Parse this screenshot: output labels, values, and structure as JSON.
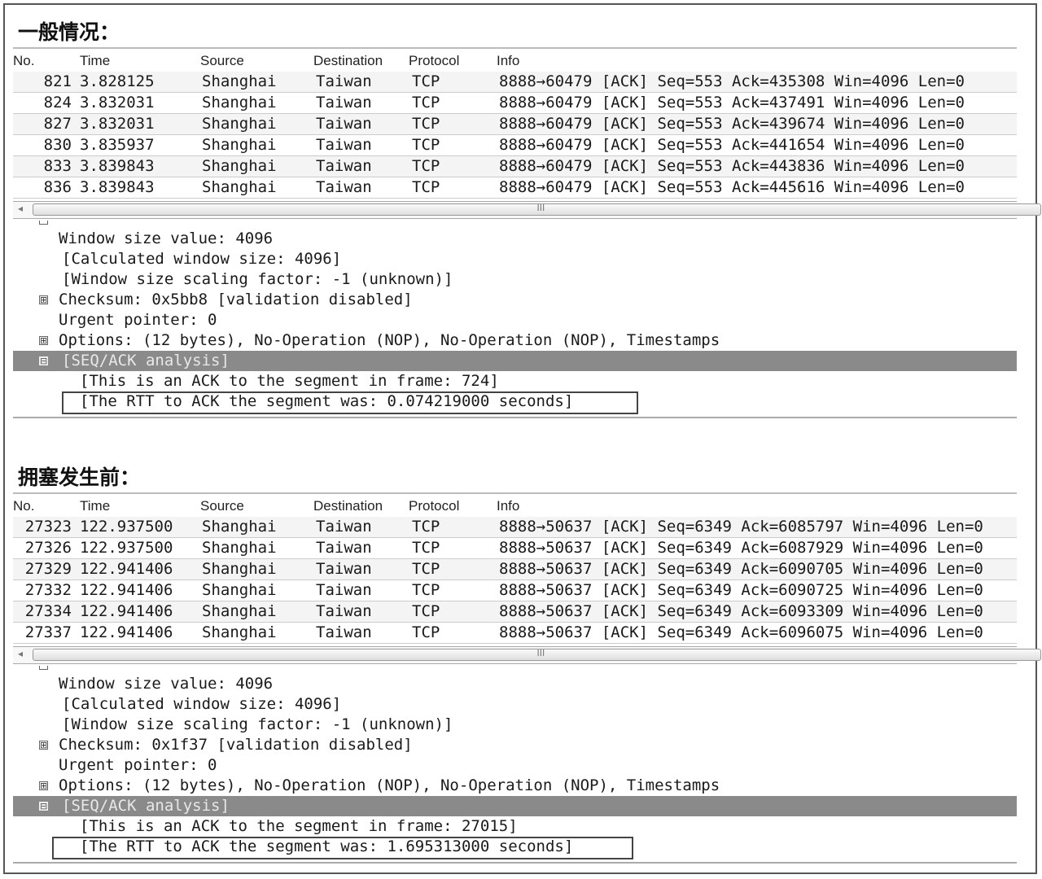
{
  "sections": [
    {
      "title": "一般情况：",
      "columns": [
        "No.",
        "Time",
        "Source",
        "Destination",
        "Protocol",
        "Info"
      ],
      "rows": [
        {
          "no": "821",
          "time": "3.828125",
          "src": "Shanghai",
          "dst": "Taiwan",
          "proto": "TCP",
          "info": "8888→60479 [ACK] Seq=553 Ack=435308 Win=4096 Len=0"
        },
        {
          "no": "824",
          "time": "3.832031",
          "src": "Shanghai",
          "dst": "Taiwan",
          "proto": "TCP",
          "info": "8888→60479 [ACK] Seq=553 Ack=437491 Win=4096 Len=0"
        },
        {
          "no": "827",
          "time": "3.832031",
          "src": "Shanghai",
          "dst": "Taiwan",
          "proto": "TCP",
          "info": "8888→60479 [ACK] Seq=553 Ack=439674 Win=4096 Len=0"
        },
        {
          "no": "830",
          "time": "3.835937",
          "src": "Shanghai",
          "dst": "Taiwan",
          "proto": "TCP",
          "info": "8888→60479 [ACK] Seq=553 Ack=441654 Win=4096 Len=0"
        },
        {
          "no": "833",
          "time": "3.839843",
          "src": "Shanghai",
          "dst": "Taiwan",
          "proto": "TCP",
          "info": "8888→60479 [ACK] Seq=553 Ack=443836 Win=4096 Len=0"
        },
        {
          "no": "836",
          "time": "3.839843",
          "src": "Shanghai",
          "dst": "Taiwan",
          "proto": "TCP",
          "info": "8888→60479 [ACK] Seq=553 Ack=445616 Win=4096 Len=0"
        }
      ],
      "scroll_grip": "III",
      "details": {
        "window_size": "Window size value: 4096",
        "calc_window": "[Calculated window size: 4096]",
        "scaling": "[Window size scaling factor: -1 (unknown)]",
        "checksum": "Checksum: 0x5bb8 [validation disabled]",
        "urgent": "Urgent pointer: 0",
        "options": "Options: (12 bytes), No-Operation (NOP), No-Operation (NOP), Timestamps",
        "seq_ack": "[SEQ/ACK analysis]",
        "ack_frame": "[This is an ACK to the segment in frame: 724]",
        "rtt": "[The RTT to ACK the segment was: 0.074219000 seconds]"
      }
    },
    {
      "title": "拥塞发生前：",
      "columns": [
        "No.",
        "Time",
        "Source",
        "Destination",
        "Protocol",
        "Info"
      ],
      "rows": [
        {
          "no": "27323",
          "time": "122.937500",
          "src": "Shanghai",
          "dst": "Taiwan",
          "proto": "TCP",
          "info": "8888→50637 [ACK] Seq=6349 Ack=6085797 Win=4096 Len=0"
        },
        {
          "no": "27326",
          "time": "122.937500",
          "src": "Shanghai",
          "dst": "Taiwan",
          "proto": "TCP",
          "info": "8888→50637 [ACK] Seq=6349 Ack=6087929 Win=4096 Len=0"
        },
        {
          "no": "27329",
          "time": "122.941406",
          "src": "Shanghai",
          "dst": "Taiwan",
          "proto": "TCP",
          "info": "8888→50637 [ACK] Seq=6349 Ack=6090705 Win=4096 Len=0"
        },
        {
          "no": "27332",
          "time": "122.941406",
          "src": "Shanghai",
          "dst": "Taiwan",
          "proto": "TCP",
          "info": "8888→50637 [ACK] Seq=6349 Ack=6090725 Win=4096 Len=0"
        },
        {
          "no": "27334",
          "time": "122.941406",
          "src": "Shanghai",
          "dst": "Taiwan",
          "proto": "TCP",
          "info": "8888→50637 [ACK] Seq=6349 Ack=6093309 Win=4096 Len=0"
        },
        {
          "no": "27337",
          "time": "122.941406",
          "src": "Shanghai",
          "dst": "Taiwan",
          "proto": "TCP",
          "info": "8888→50637 [ACK] Seq=6349 Ack=6096075 Win=4096 Len=0"
        }
      ],
      "scroll_grip": "III",
      "details": {
        "window_size": "Window size value: 4096",
        "calc_window": "[Calculated window size: 4096]",
        "scaling": "[Window size scaling factor: -1 (unknown)]",
        "checksum": "Checksum: 0x1f37 [validation disabled]",
        "urgent": "Urgent pointer: 0",
        "options": "Options: (12 bytes), No-Operation (NOP), No-Operation (NOP), Timestamps",
        "seq_ack": "[SEQ/ACK analysis]",
        "ack_frame": "[This is an ACK to the segment in frame: 27015]",
        "rtt": "[The RTT to ACK the segment was: 1.695313000 seconds]"
      }
    }
  ],
  "icons": {
    "expand": "⊞",
    "collapse": "⊟",
    "scroll_left": "◂"
  }
}
